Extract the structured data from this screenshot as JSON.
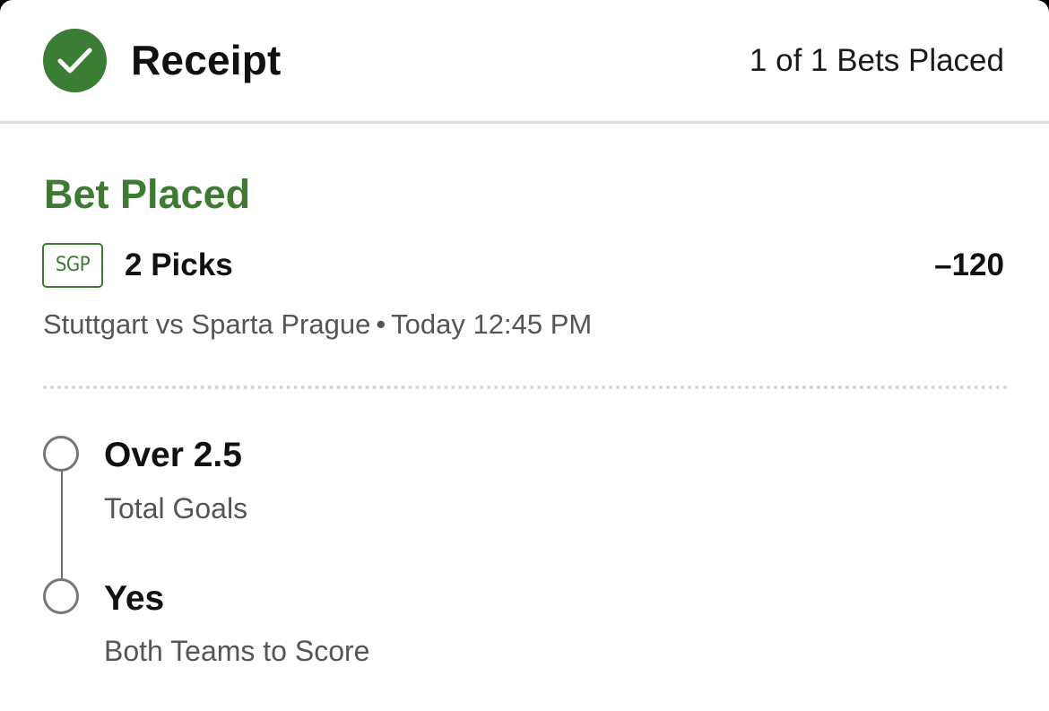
{
  "header": {
    "title": "Receipt",
    "bets_count": "1 of 1 Bets Placed",
    "status_icon": "check-circle-icon"
  },
  "bet": {
    "status": "Bet Placed",
    "badge": "SGP",
    "picks_label": "2 Picks",
    "odds": "–120",
    "event": "Stuttgart vs Sparta Prague",
    "separator": "•",
    "time": "Today 12:45 PM",
    "picks": [
      {
        "selection": "Over 2.5",
        "market": "Total Goals"
      },
      {
        "selection": "Yes",
        "market": "Both Teams to Score"
      }
    ]
  },
  "colors": {
    "accent_green": "#3f7a33",
    "badge_green": "#3b7d34",
    "text_primary": "#111111",
    "text_secondary": "#555555"
  }
}
